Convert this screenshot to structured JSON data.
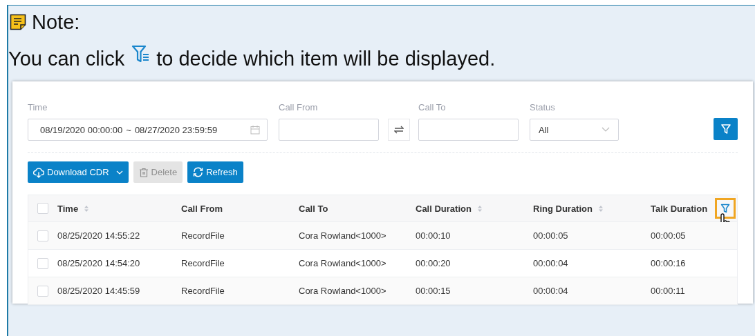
{
  "note": {
    "title": "Note:",
    "text_before": "You can click",
    "text_after": "to decide which item will be displayed."
  },
  "filters": {
    "time": {
      "label": "Time",
      "start": "08/19/2020 00:00:00",
      "separator": "~",
      "end": "08/27/2020 23:59:59"
    },
    "call_from": {
      "label": "Call From"
    },
    "call_to": {
      "label": "Call To"
    },
    "status": {
      "label": "Status",
      "value": "All"
    }
  },
  "toolbar": [
    {
      "kind": "download",
      "label": "Download CDR",
      "disabled": false
    },
    {
      "kind": "delete",
      "label": "Delete",
      "disabled": true
    },
    {
      "kind": "refresh",
      "label": "Refresh",
      "disabled": false
    }
  ],
  "table": {
    "columns": [
      {
        "label": "Time",
        "sortable": true
      },
      {
        "label": "Call From",
        "sortable": false
      },
      {
        "label": "Call To",
        "sortable": false
      },
      {
        "label": "Call Duration",
        "sortable": true
      },
      {
        "label": "Ring Duration",
        "sortable": true
      },
      {
        "label": "Talk Duration",
        "sortable": false
      }
    ],
    "column_filter_highlighted": true,
    "header_checked": false,
    "rows": [
      {
        "checked": false,
        "cells": [
          "08/25/2020 14:55:22",
          "RecordFile",
          "Cora Rowland<1000>",
          "00:00:10",
          "00:00:05",
          "00:00:05"
        ]
      },
      {
        "checked": false,
        "cells": [
          "08/25/2020 14:54:20",
          "RecordFile",
          "Cora Rowland<1000>",
          "00:00:20",
          "00:00:04",
          "00:00:16"
        ]
      },
      {
        "checked": false,
        "cells": [
          "08/25/2020 14:45:59",
          "RecordFile",
          "Cora Rowland<1000>",
          "00:00:15",
          "00:00:04",
          "00:00:11"
        ]
      }
    ]
  }
}
